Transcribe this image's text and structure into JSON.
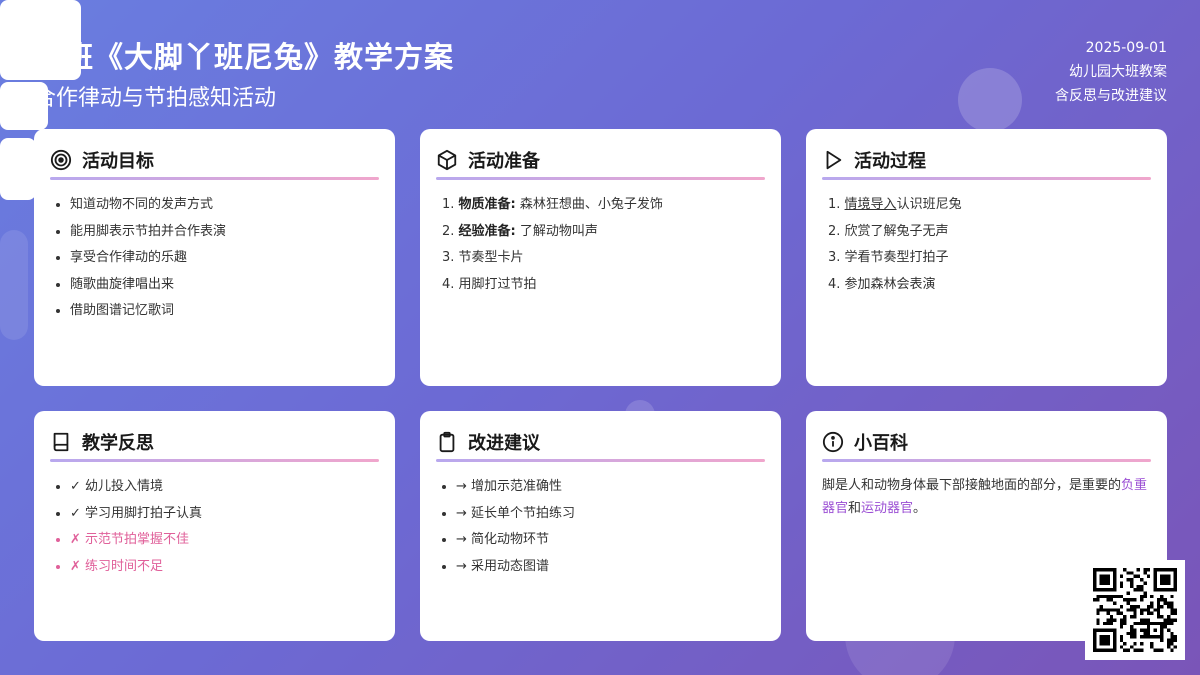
{
  "header": {
    "title": "大班《大脚丫班尼兔》教学方案",
    "subtitle": "合作律动与节拍感知活动",
    "date": "2025-09-01",
    "class_info": "幼儿园大班教案",
    "extra": "含反思与改进建议"
  },
  "cards": {
    "goals": {
      "title": "活动目标",
      "icon": "target-icon",
      "items": [
        "知道动物不同的发声方式",
        "能用脚表示节拍并合作表演",
        "享受合作律动的乐趣",
        "随歌曲旋律唱出来",
        "借助图谱记忆歌词"
      ]
    },
    "prep": {
      "title": "活动准备",
      "icon": "cube-icon",
      "items": [
        {
          "num": "1.",
          "label": "物质准备:",
          "text": " 森林狂想曲、小兔子发饰"
        },
        {
          "num": "2.",
          "label": "经验准备:",
          "text": " 了解动物叫声"
        },
        {
          "num": "3.",
          "label": "",
          "text": "节奏型卡片"
        },
        {
          "num": "4.",
          "label": "",
          "text": "用脚打过节拍"
        }
      ]
    },
    "process": {
      "title": "活动过程",
      "icon": "play-icon",
      "items": [
        {
          "num": "1.",
          "link": "情境导入",
          "text": "认识班尼兔"
        },
        {
          "num": "2.",
          "link": "",
          "text": "欣赏了解兔子无声"
        },
        {
          "num": "3.",
          "link": "",
          "text": "学看节奏型打拍子"
        },
        {
          "num": "4.",
          "link": "",
          "text": "参加森林会表演"
        }
      ]
    },
    "reflection": {
      "title": "教学反思",
      "icon": "book-icon",
      "positive": [
        "✓ 幼儿投入情境",
        "✓ 学习用脚打拍子认真"
      ],
      "negative": [
        "✗ 示范节拍掌握不佳",
        "✗ 练习时间不足"
      ]
    },
    "improve": {
      "title": "改进建议",
      "icon": "clipboard-icon",
      "items": [
        "→ 增加示范准确性",
        "→ 延长单个节拍练习",
        "→ 简化动物环节",
        "→ 采用动态图谱"
      ]
    },
    "wiki": {
      "title": "小百科",
      "icon": "info-icon",
      "text_before": "脚是人和动物身体最下部接触地面的部分，是重要的",
      "hl1": "负重器官",
      "mid": "和",
      "hl2": "运动器官",
      "end": "。"
    }
  },
  "colors": {
    "accent_negative": "#e0609a",
    "accent_highlight": "#9b4fd4"
  }
}
